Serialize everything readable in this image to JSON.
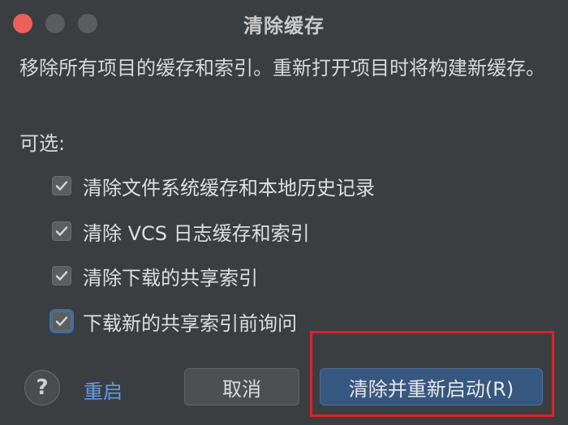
{
  "window": {
    "title": "清除缓存"
  },
  "description": "移除所有项目的缓存和索引。重新打开项目时将构建新缓存。",
  "optional_label": "可选:",
  "options": [
    {
      "label": "清除文件系统缓存和本地历史记录",
      "checked": true
    },
    {
      "label": "清除 VCS 日志缓存和索引",
      "checked": true
    },
    {
      "label": "清除下载的共享索引",
      "checked": true
    },
    {
      "label": "下载新的共享索引前询问",
      "checked": true,
      "focused": true
    }
  ],
  "footer": {
    "help_label": "?",
    "restart_label": "重启",
    "cancel_label": "取消",
    "primary_label": "清除并重新启动(R)"
  },
  "colors": {
    "link": "#5c9ded",
    "primary_button": "#365880",
    "highlight": "#e0202a",
    "close": "#ee5f57"
  }
}
